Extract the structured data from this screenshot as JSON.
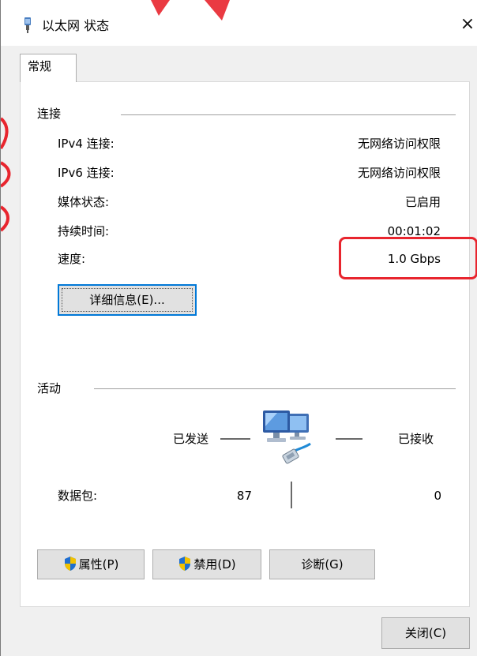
{
  "window": {
    "title": "以太网 状态",
    "close_glyph": "×"
  },
  "tabs": [
    {
      "label": "常规",
      "selected": true
    }
  ],
  "connection": {
    "group_label": "连接",
    "rows": [
      {
        "label": "IPv4 连接:",
        "value": "无网络访问权限"
      },
      {
        "label": "IPv6 连接:",
        "value": "无网络访问权限"
      },
      {
        "label": "媒体状态:",
        "value": "已启用"
      },
      {
        "label": "持续时间:",
        "value": "00:01:02"
      },
      {
        "label": "速度:",
        "value": "1.0 Gbps"
      }
    ],
    "details_button": "详细信息(E)..."
  },
  "activity": {
    "group_label": "活动",
    "sent_label": "已发送",
    "received_label": "已接收",
    "packets_label": "数据包:",
    "packets_sent": "87",
    "packets_received": "0",
    "icon": "network-computers-icon"
  },
  "buttons": {
    "properties": "属性(P)",
    "disable": "禁用(D)",
    "diagnose": "诊断(G)",
    "close": "关闭(C)"
  },
  "colors": {
    "highlight": "#e8252e",
    "shield_blue": "#1f6fd1",
    "shield_yellow": "#f2c200",
    "focus_blue": "#0078d7"
  }
}
